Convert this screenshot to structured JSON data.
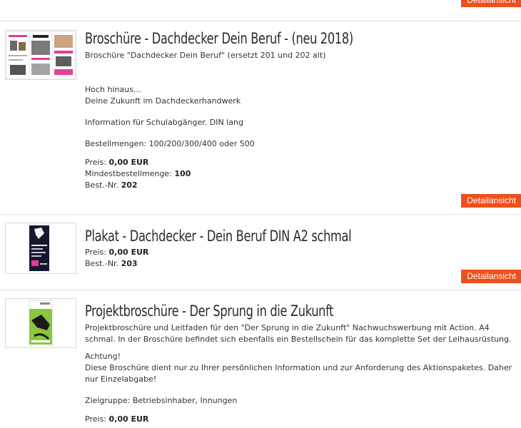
{
  "detail_label": "Detailansicht",
  "items": [
    {
      "title": "Broschüre - Dachdecker Dein Beruf - (neu 2018)",
      "subtitle": "Broschüre \"Dachdecker Dein Beruf\" (ersetzt 201 und 202 alt)",
      "desc1": "Hoch hinaus...",
      "desc2": "Deine Zukunft im Dachdeckerhandwerk",
      "desc3": "Information für Schulabgänger. DIN lang",
      "desc4": "Bestellmengen: 100/200/300/400 oder 500",
      "price_label": "Preis:",
      "price": "0,00 EUR",
      "min_label": "Mindestbestellmenge:",
      "min": "100",
      "nr_label": "Best.-Nr.",
      "nr": "202"
    },
    {
      "title": "Plakat - Dachdecker - Dein Beruf DIN A2 schmal",
      "price_label": "Preis:",
      "price": "0,00 EUR",
      "nr_label": "Best.-Nr.",
      "nr": "203"
    },
    {
      "title": "Projektbroschüre - Der Sprung in die Zukunft",
      "desc1": "Projektbroschüre und Leitfaden für den \"Der Sprung in die Zukunft\" Nachwuchswerbung mit Action. A4",
      "desc2": "schmal. In der Broschüre befindet sich ebenfalls ein Bestellschein für das komplette Set der Leihausrüstung.",
      "desc3": "Achtung!",
      "desc4": "Diese Broschüre dient nur zu Ihrer persönlichen Information und zur Anforderung des Aktionspaketes. Daher",
      "desc5": "nur Einzelabgabe!",
      "desc6": "Zielgruppe: Betriebsinhaber, Innungen",
      "price_label": "Preis:",
      "price": "0,00 EUR"
    }
  ]
}
